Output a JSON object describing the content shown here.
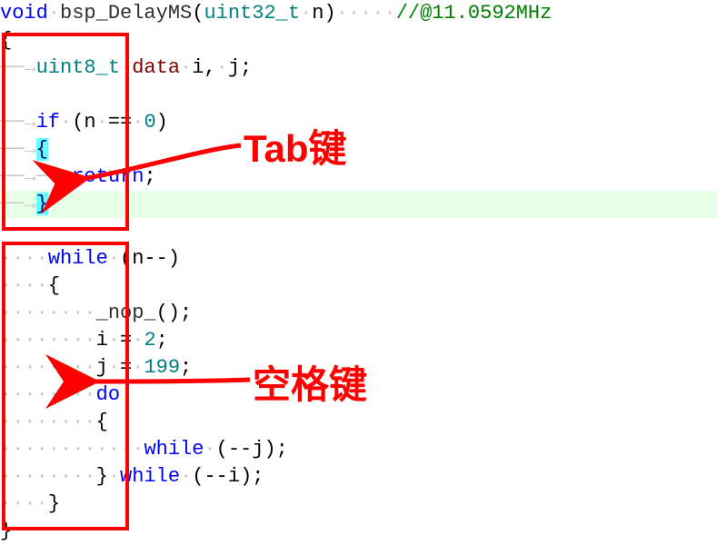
{
  "code": {
    "l1": {
      "kw_void": "void",
      "fn": "bsp_DelayMS",
      "p_open": "(",
      "type": "uint32_t",
      "space": "·",
      "param": "n",
      "p_close": ")",
      "trail_ws": "·····",
      "cmt": "//@11.0592MHz"
    },
    "l2": {
      "brace": "{"
    },
    "l3": {
      "tab": "──→",
      "type": "uint8_t",
      "space": "·",
      "dat": "data",
      "space2": "·",
      "rest": "i,",
      "space3": "·",
      "rest2": "j;"
    },
    "l4": {
      "blank": ""
    },
    "l5": {
      "tab": "──→",
      "kw_if": "if",
      "sp": "·",
      "p_open": "(",
      "var": "n",
      "sp2": "·",
      "op": "==",
      "sp3": "·",
      "num": "0",
      "p_close": ")"
    },
    "l6": {
      "tab": "──→",
      "brace": "{"
    },
    "l7": {
      "tab1": "──→",
      "tab2": "──→",
      "kw_return": "return",
      "semi": ";"
    },
    "l8": {
      "tab": "──→",
      "brace": "}"
    },
    "l9": {
      "blank": ""
    },
    "l10": {
      "ws": "····",
      "kw_while": "while",
      "sp": "·",
      "p_open": "(",
      "expr": "n--",
      "p_close": ")"
    },
    "l11": {
      "ws": "····",
      "brace": "{"
    },
    "l12": {
      "ws": "········",
      "fn": "_nop_",
      "p_open": "(",
      "p_close": ")",
      "semi": ";"
    },
    "l13": {
      "ws": "········",
      "var": "i",
      "sp1": "·",
      "eq": "=",
      "sp2": "·",
      "num": "2",
      "semi": ";"
    },
    "l14": {
      "ws": "········",
      "var": "j",
      "sp1": "·",
      "eq": "=",
      "sp2": "·",
      "num": "199",
      "semi": ";"
    },
    "l15": {
      "ws": "········",
      "kw_do": "do"
    },
    "l16": {
      "ws": "········",
      "brace": "{"
    },
    "l17": {
      "ws": "············",
      "kw_while": "while",
      "sp": "·",
      "p_open": "(",
      "expr": "--j",
      "p_close": ")",
      "semi": ";"
    },
    "l18": {
      "ws": "········",
      "brace": "}",
      "sp": "·",
      "kw_while": "while",
      "sp2": "·",
      "p_open": "(",
      "expr": "--i",
      "p_close": ")",
      "semi": ";"
    },
    "l19": {
      "ws": "····",
      "brace": "}"
    },
    "l20": {
      "brace": "}"
    }
  },
  "annotations": {
    "tab_label": "Tab键",
    "space_label": "空格键"
  }
}
